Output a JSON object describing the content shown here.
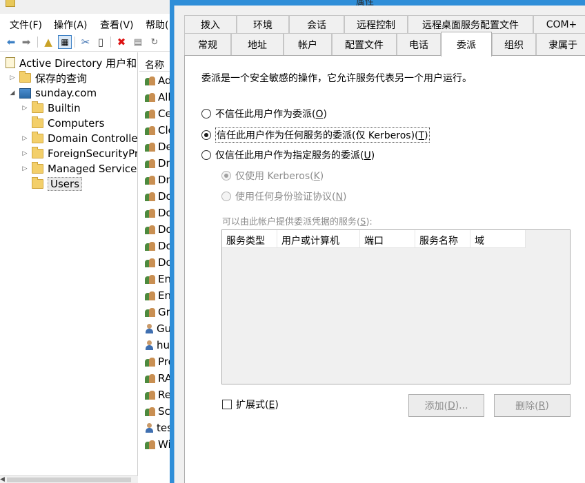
{
  "mmc": {
    "menu": [
      "文件(F)",
      "操作(A)",
      "查看(V)",
      "帮助("
    ],
    "tree": {
      "root": "Active Directory 用户和",
      "saved_queries": "保存的查询",
      "domain": "sunday.com",
      "children": [
        "Builtin",
        "Computers",
        "Domain Controlle",
        "ForeignSecurityPr",
        "Managed Service",
        "Users"
      ]
    },
    "list": {
      "header": "名称",
      "items": [
        "Ad",
        "All",
        "Ce",
        "Clo",
        "De",
        "Dn",
        "Dn",
        "Do",
        "Do",
        "Do",
        "Do",
        "Do",
        "Ent",
        "Ent",
        "Gro",
        "Gu",
        "hu",
        "Pro",
        "RA",
        "Re",
        "Scl",
        "tes",
        "Wi"
      ]
    }
  },
  "dialog": {
    "title": "属性",
    "tabs_row1": [
      "拨入",
      "环境",
      "会话",
      "远程控制",
      "远程桌面服务配置文件",
      "COM+"
    ],
    "tabs_row2": [
      "常规",
      "地址",
      "帐户",
      "配置文件",
      "电话",
      "委派",
      "组织",
      "隶属于"
    ],
    "active_tab": "委派",
    "description": "委派是一个安全敏感的操作，它允许服务代表另一个用户运行。",
    "radio_no_trust": {
      "text": "不信任此用户作为委派(",
      "key": "O",
      "tail": ")"
    },
    "radio_trust_any": {
      "text": "信任此用户作为任何服务的委派(仅 Kerberos)(",
      "key": "T",
      "tail": ")"
    },
    "radio_trust_specified": {
      "text": "仅信任此用户作为指定服务的委派(",
      "key": "U",
      "tail": ")"
    },
    "radio_kerberos_only": {
      "text": "仅使用 Kerberos(",
      "key": "K",
      "tail": ")"
    },
    "radio_any_protocol": {
      "text": "使用任何身份验证协议(",
      "key": "N",
      "tail": ")"
    },
    "services_label": {
      "text": "可以由此帐户提供委派凭据的服务(",
      "key": "S",
      "tail": "):"
    },
    "table_headers": [
      "服务类型",
      "用户或计算机",
      "端口",
      "服务名称",
      "域"
    ],
    "expanded": {
      "text": "扩展式(",
      "key": "E",
      "tail": ")"
    },
    "add_button": {
      "text": "添加(",
      "key": "D",
      "tail": ")..."
    },
    "remove_button": {
      "text": "删除(",
      "key": "R",
      "tail": ")"
    }
  }
}
